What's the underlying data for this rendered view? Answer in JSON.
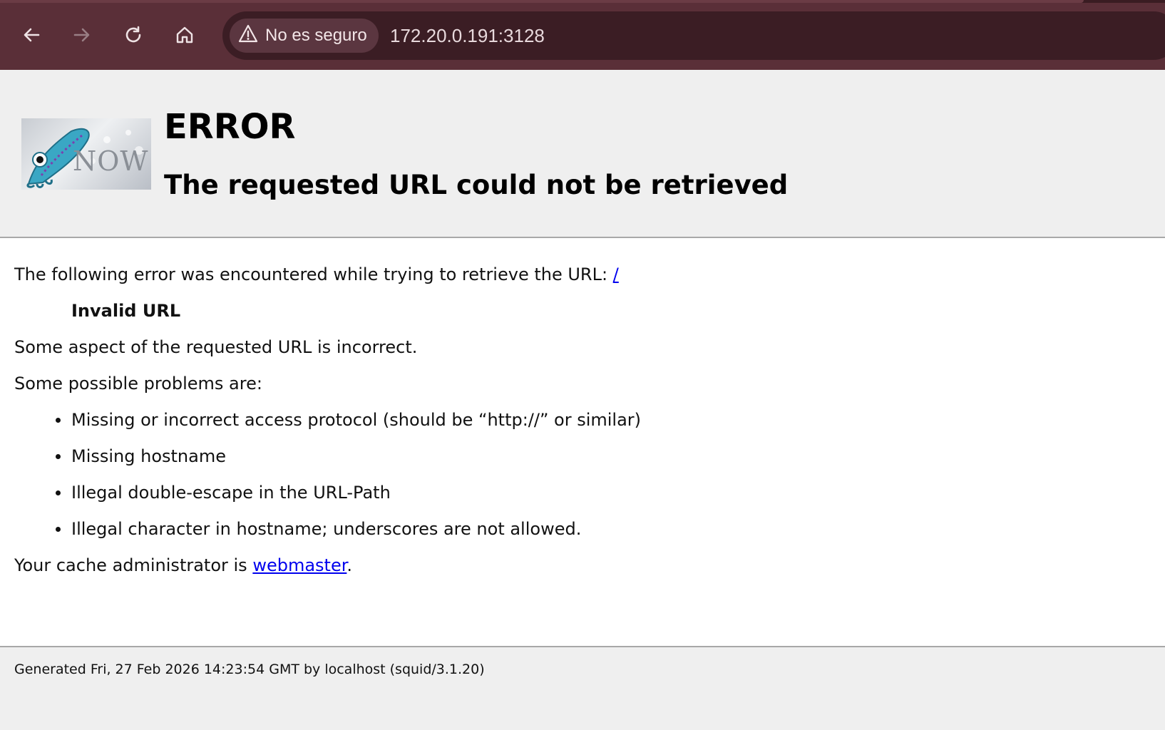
{
  "browser": {
    "security_label": "No es seguro",
    "url": "172.20.0.191:3128",
    "icons": [
      "back-arrow-icon",
      "forward-arrow-icon",
      "reload-icon",
      "home-icon",
      "warning-triangle-icon"
    ],
    "colors": {
      "toolbar": "#5a2f38",
      "omnibox": "#3b1d24",
      "chip": "#5b3640"
    }
  },
  "header": {
    "logo_text": "NOW",
    "title": "ERROR",
    "subtitle": "The requested URL could not be retrieved"
  },
  "content": {
    "intro": "The following error was encountered while trying to retrieve the URL:",
    "intro_link": "/",
    "error_name": "Invalid URL",
    "description": "Some aspect of the requested URL is incorrect.",
    "problems_heading": "Some possible problems are:",
    "problems": [
      "Missing or incorrect access protocol (should be “http://” or similar)",
      "Missing hostname",
      "Illegal double-escape in the URL-Path",
      "Illegal character in hostname; underscores are not allowed."
    ],
    "admin_prefix": "Your cache administrator is",
    "admin_link": "webmaster",
    "admin_suffix": "."
  },
  "footer": {
    "generated": "Generated Fri, 27 Feb 2026 14:23:54 GMT by localhost (squid/3.1.20)"
  }
}
